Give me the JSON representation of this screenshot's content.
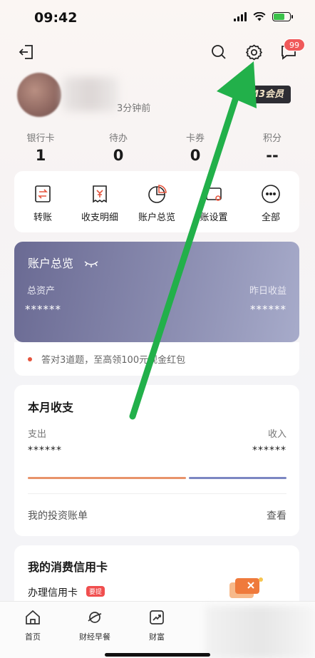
{
  "status_bar": {
    "time": "09:42"
  },
  "header": {
    "messages_badge": "99"
  },
  "profile": {
    "last_login": "3分钟前",
    "member_badge": "M3会员"
  },
  "stats": [
    {
      "label": "银行卡",
      "value": "1"
    },
    {
      "label": "待办",
      "value": "0"
    },
    {
      "label": "卡券",
      "value": "0"
    },
    {
      "label": "积分",
      "value": "--"
    }
  ],
  "quick_actions": [
    {
      "label": "转账",
      "icon": "transfer-icon"
    },
    {
      "label": "收支明细",
      "icon": "receipt-icon"
    },
    {
      "label": "账户总览",
      "icon": "pie-chart-icon"
    },
    {
      "label": "账设置",
      "icon": "card-settings-icon"
    },
    {
      "label": "全部",
      "icon": "more-icon"
    }
  ],
  "overview": {
    "title": "账户总览",
    "total_assets_label": "总资产",
    "total_assets_value": "******",
    "yesterday_label": "昨日收益",
    "yesterday_value": "******"
  },
  "promo": {
    "text": "答对3道题，至高领100元现金红包"
  },
  "monthly": {
    "title": "本月收支",
    "expense_label": "支出",
    "expense_value": "******",
    "income_label": "收入",
    "income_value": "******",
    "invest_label": "我的投资账单",
    "view_label": "查看"
  },
  "credit_card": {
    "title": "我的消费信用卡",
    "apply_label": "办理信用卡",
    "tag": "要提"
  },
  "bottom_nav": [
    {
      "label": "首页",
      "icon": "home-icon"
    },
    {
      "label": "财经早餐",
      "icon": "planet-icon"
    },
    {
      "label": "财富",
      "icon": "trend-chart-icon"
    }
  ],
  "colors": {
    "accent_green": "#22b04a",
    "badge_red": "#f0595a",
    "overview_purple": "#7a7ca2"
  }
}
